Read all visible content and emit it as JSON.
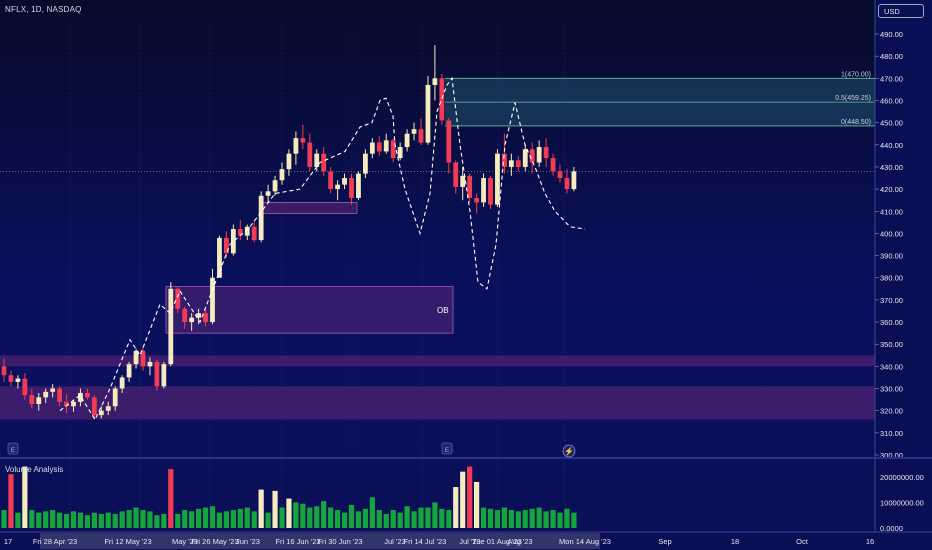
{
  "header": {
    "title": "NFLX, 1D, NASDAQ",
    "currency": "USD"
  },
  "volume_panel": {
    "title": "Volume Analysis"
  },
  "chart_data": [
    {
      "type": "candlestick",
      "ylim": [
        300,
        495
      ],
      "y_ticks": [
        "490.00",
        "480.00",
        "470.00",
        "460.00",
        "450.00",
        "440.00",
        "430.00",
        "420.00",
        "410.00",
        "400.00",
        "390.00",
        "380.00",
        "370.00",
        "360.00",
        "350.00",
        "340.00",
        "330.00",
        "320.00",
        "310.00",
        "300.00"
      ],
      "x_tick_labels": [
        "17",
        "Fri 28 Apr '23",
        "Fri 12 May '23",
        "May '23",
        "Fri 26 May '23",
        "Jun '23",
        "Fri 16 Jun '23",
        "Fri 30 Jun '23",
        "Jul '23",
        "Fri 14 Jul '23",
        "Jul '23",
        "Tue 01 Aug '23",
        "Aug '23",
        "Mon 14 Aug '23",
        "Sep",
        "18",
        "Oct",
        "16"
      ],
      "fib_levels": [
        {
          "label": "1(470.00)",
          "value": 470.0
        },
        {
          "label": "0.5(459.25)",
          "value": 459.25
        },
        {
          "label": "0(448.50)",
          "value": 448.5
        }
      ],
      "zones": [
        {
          "label": "OB",
          "low": 355,
          "high": 376
        },
        {
          "label": "",
          "low": 409,
          "high": 414
        },
        {
          "label": "",
          "low": 340,
          "high": 345
        },
        {
          "label": "",
          "low": 316,
          "high": 331
        }
      ],
      "current_price_line": 428,
      "projection_path": [
        [
          60,
          316
        ],
        [
          78,
          325
        ],
        [
          95,
          315
        ],
        [
          105,
          326
        ],
        [
          130,
          348
        ],
        [
          140,
          345
        ],
        [
          150,
          362
        ],
        [
          160,
          366
        ],
        [
          178,
          372
        ],
        [
          200,
          360
        ],
        [
          228,
          378
        ],
        [
          255,
          390
        ],
        [
          270,
          400
        ],
        [
          290,
          412
        ],
        [
          305,
          420
        ],
        [
          318,
          425
        ],
        [
          338,
          438
        ],
        [
          352,
          452
        ],
        [
          365,
          462
        ],
        [
          375,
          458
        ],
        [
          382,
          442
        ],
        [
          392,
          468
        ],
        [
          405,
          476
        ],
        [
          420,
          442
        ],
        [
          430,
          420
        ],
        [
          440,
          396
        ],
        [
          450,
          374
        ],
        [
          460,
          372
        ],
        [
          470,
          392
        ],
        [
          480,
          422
        ],
        [
          490,
          445
        ],
        [
          500,
          460
        ],
        [
          510,
          430
        ],
        [
          525,
          410
        ],
        [
          540,
          401
        ],
        [
          545,
          403
        ]
      ],
      "candles": [
        [
          340.0,
          343.5,
          333.0,
          336.0
        ],
        [
          336.0,
          338.0,
          331.0,
          333.0
        ],
        [
          333.0,
          336.0,
          330.0,
          334.5
        ],
        [
          334.5,
          337.0,
          325.0,
          327.0
        ],
        [
          327.0,
          330.0,
          321.0,
          323.0
        ],
        [
          323.0,
          328.0,
          320.0,
          326.0
        ],
        [
          326.0,
          330.0,
          323.5,
          328.5
        ],
        [
          328.5,
          332.0,
          326.0,
          330.0
        ],
        [
          330.0,
          331.0,
          322.0,
          324.0
        ],
        [
          324.0,
          327.5,
          319.0,
          322.0
        ],
        [
          322.0,
          325.0,
          319.5,
          324.0
        ],
        [
          324.0,
          330.0,
          322.0,
          328.0
        ],
        [
          328.0,
          330.0,
          325.0,
          326.0
        ],
        [
          326.0,
          327.0,
          316.0,
          318.0
        ],
        [
          318.0,
          322.0,
          316.5,
          320.0
        ],
        [
          320.0,
          324.0,
          318.0,
          322.0
        ],
        [
          322.0,
          331.0,
          320.0,
          330.0
        ],
        [
          330.0,
          336.0,
          328.0,
          335.0
        ],
        [
          335.0,
          342.0,
          333.0,
          341.0
        ],
        [
          341.0,
          348.0,
          339.0,
          347.0
        ],
        [
          347.0,
          349.0,
          338.0,
          340.0
        ],
        [
          340.0,
          344.0,
          336.0,
          342.0
        ],
        [
          342.0,
          343.0,
          329.0,
          331.0
        ],
        [
          331.0,
          342.0,
          330.0,
          341.0
        ],
        [
          341.0,
          378.0,
          340.0,
          375.0
        ],
        [
          375.0,
          376.0,
          364.0,
          366.0
        ],
        [
          366.0,
          367.0,
          357.0,
          360.0
        ],
        [
          360.0,
          364.0,
          356.0,
          362.0
        ],
        [
          362.0,
          366.0,
          359.0,
          364.0
        ],
        [
          364.0,
          366.0,
          358.0,
          360.0
        ],
        [
          360.0,
          384.0,
          359.0,
          380.0
        ],
        [
          380.0,
          399.0,
          390.0,
          398.0
        ],
        [
          398.0,
          401.0,
          389.0,
          391.0
        ],
        [
          391.0,
          404.0,
          390.0,
          402.0
        ],
        [
          402.0,
          406.0,
          397.0,
          399.0
        ],
        [
          399.0,
          404.0,
          397.0,
          403.0
        ],
        [
          403.0,
          406.0,
          396.0,
          397.0
        ],
        [
          397.0,
          419.0,
          396.0,
          417.0
        ],
        [
          417.0,
          422.0,
          414.0,
          419.0
        ],
        [
          419.0,
          426.0,
          417.0,
          424.0
        ],
        [
          424.0,
          432.0,
          422.0,
          429.0
        ],
        [
          429.0,
          438.0,
          426.0,
          436.0
        ],
        [
          436.0,
          446.0,
          431.0,
          443.0
        ],
        [
          443.0,
          449.0,
          438.0,
          441.0
        ],
        [
          441.0,
          445.0,
          428.0,
          430.0
        ],
        [
          430.0,
          438.0,
          428.0,
          436.0
        ],
        [
          436.0,
          439.0,
          426.0,
          428.0
        ],
        [
          428.0,
          430.0,
          418.0,
          420.0
        ],
        [
          420.0,
          424.0,
          415.0,
          422.0
        ],
        [
          422.0,
          427.0,
          420.0,
          425.0
        ],
        [
          425.0,
          427.0,
          413.0,
          416.0
        ],
        [
          416.0,
          428.0,
          415.0,
          427.0
        ],
        [
          427.0,
          438.0,
          425.0,
          436.0
        ],
        [
          436.0,
          443.0,
          434.0,
          441.0
        ],
        [
          441.0,
          444.0,
          435.0,
          437.0
        ],
        [
          437.0,
          445.0,
          436.0,
          442.0
        ],
        [
          442.0,
          443.0,
          432.0,
          434.0
        ],
        [
          434.0,
          441.0,
          433.0,
          439.0
        ],
        [
          439.0,
          447.0,
          437.0,
          445.0
        ],
        [
          445.0,
          450.0,
          442.0,
          447.0
        ],
        [
          447.0,
          452.0,
          440.0,
          441.0
        ],
        [
          441.0,
          471.0,
          440.0,
          467.0
        ],
        [
          467.0,
          485.0,
          460.0,
          470.0
        ],
        [
          470.0,
          472.0,
          449.0,
          451.0
        ],
        [
          451.0,
          452.0,
          427.0,
          432.0
        ],
        [
          432.0,
          433.0,
          418.0,
          421.0
        ],
        [
          421.0,
          430.0,
          415.0,
          426.0
        ],
        [
          426.0,
          427.0,
          414.0,
          416.0
        ],
        [
          416.0,
          418.0,
          409.0,
          414.0
        ],
        [
          414.0,
          427.0,
          412.0,
          425.0
        ],
        [
          425.0,
          426.0,
          411.0,
          413.0
        ],
        [
          413.0,
          438.0,
          412.0,
          436.0
        ],
        [
          436.0,
          445.0,
          427.0,
          430.0
        ],
        [
          430.0,
          436.0,
          426.0,
          433.0
        ],
        [
          433.0,
          435.0,
          428.0,
          430.0
        ],
        [
          430.0,
          440.0,
          428.0,
          438.0
        ],
        [
          438.0,
          441.0,
          427.0,
          432.0
        ],
        [
          432.0,
          442.0,
          430.0,
          439.0
        ],
        [
          439.0,
          443.0,
          430.0,
          434.0
        ],
        [
          434.0,
          436.0,
          426.0,
          428.0
        ],
        [
          428.0,
          431.0,
          423.0,
          425.0
        ],
        [
          425.0,
          429.0,
          418.0,
          420.0
        ],
        [
          420.0,
          430.0,
          419.0,
          428.0
        ]
      ]
    },
    {
      "type": "bar",
      "title": "Volume Analysis",
      "ylim": [
        0,
        25000000
      ],
      "y_ticks": [
        "20000000.00",
        "10000000.00",
        "0.0000"
      ],
      "values": [
        7000000,
        21000000,
        6000000,
        24000000,
        7000000,
        6000000,
        6500000,
        7000000,
        6000000,
        5500000,
        6500000,
        6000000,
        5000000,
        6000000,
        5500000,
        6000000,
        5500000,
        6500000,
        7000000,
        8000000,
        7000000,
        6500000,
        5000000,
        5500000,
        23000000,
        5500000,
        7000000,
        6500000,
        7500000,
        8000000,
        8500000,
        6000000,
        6500000,
        7000000,
        7500000,
        8000000,
        6500000,
        15000000,
        6000000,
        14500000,
        8000000,
        11500000,
        10000000,
        9500000,
        8000000,
        8500000,
        10500000,
        8000000,
        7000000,
        6000000,
        9000000,
        6500000,
        7500000,
        12000000,
        7000000,
        5500000,
        7000000,
        6000000,
        8500000,
        6500000,
        8000000,
        8000000,
        10000000,
        7500000,
        7000000,
        16000000,
        22000000,
        24000000,
        18000000,
        8000000,
        7500000,
        7000000,
        8000000,
        7000000,
        6500000,
        7000000,
        7500000,
        8000000,
        6500000,
        7000000,
        6000000,
        7500000,
        6000000
      ],
      "bar_colors": [
        "green",
        "red",
        "green",
        "cream",
        "green",
        "green",
        "green",
        "green",
        "green",
        "green",
        "green",
        "green",
        "green",
        "green",
        "green",
        "green",
        "green",
        "green",
        "green",
        "green",
        "green",
        "green",
        "green",
        "green",
        "red",
        "green",
        "green",
        "green",
        "green",
        "green",
        "green",
        "green",
        "green",
        "green",
        "green",
        "green",
        "green",
        "cream",
        "green",
        "cream",
        "green",
        "cream",
        "green",
        "green",
        "green",
        "green",
        "green",
        "green",
        "green",
        "green",
        "green",
        "green",
        "green",
        "green",
        "green",
        "green",
        "green",
        "green",
        "green",
        "green",
        "green",
        "green",
        "green",
        "green",
        "green",
        "cream",
        "cream",
        "red",
        "cream",
        "green",
        "green",
        "green",
        "green",
        "green",
        "green",
        "green",
        "green",
        "green",
        "green",
        "green",
        "green",
        "green",
        "green"
      ]
    }
  ],
  "colors": {
    "bull": "#f4ecbf",
    "bear": "#f23c55",
    "volume_green": "#15a53d",
    "zone": "#6b2a7a",
    "fib": "#6fb7a4"
  }
}
